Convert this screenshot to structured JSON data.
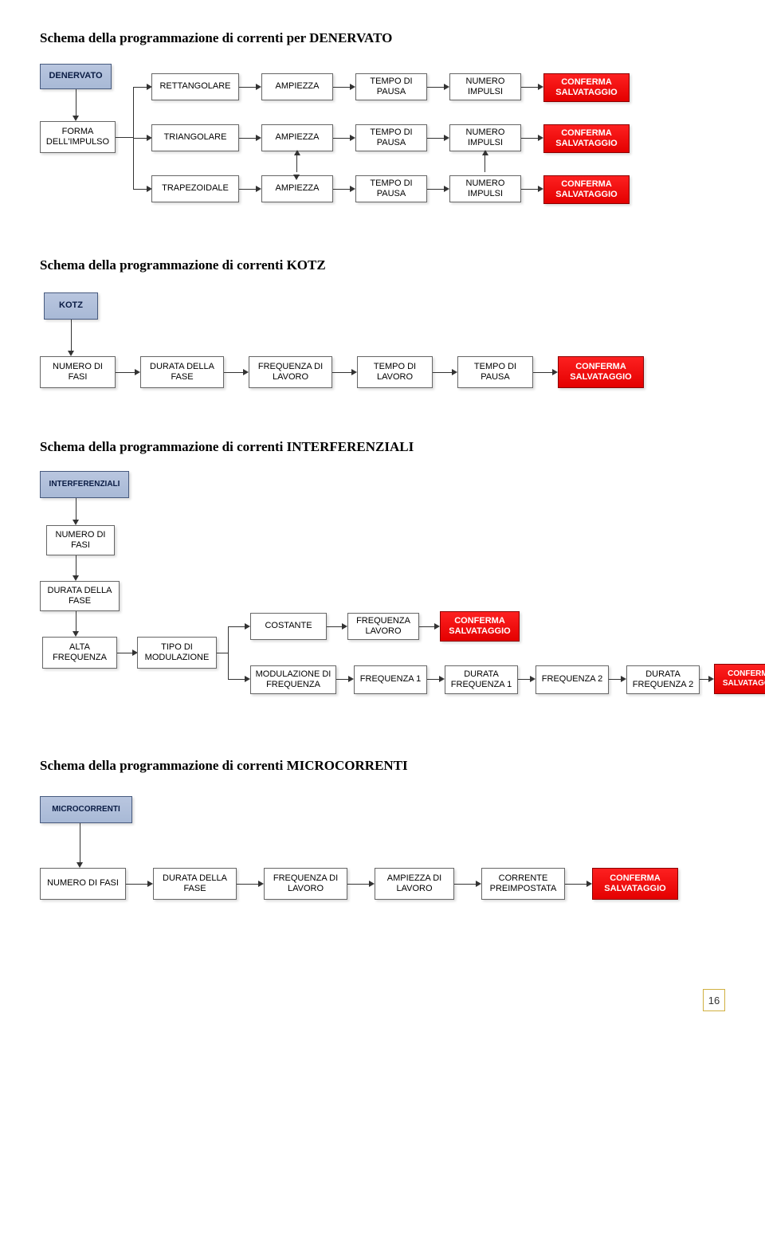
{
  "headings": {
    "denervato": "Schema della programmazione di correnti per DENERVATO",
    "kotz": "Schema della programmazione di correnti KOTZ",
    "interferenziali": "Schema della programmazione di correnti INTERFERENZIALI",
    "microcorrenti": "Schema della programmazione di correnti MICROCORRENTI"
  },
  "boxes": {
    "denervato": "DENERVATO",
    "forma_impulso": "FORMA DELL'IMPULSO",
    "rettangolare": "RETTANGOLARE",
    "triangolare": "TRIANGOLARE",
    "trapezoidale": "TRAPEZOIDALE",
    "ampiezza": "AMPIEZZA",
    "tempo_pausa": "TEMPO DI PAUSA",
    "numero_impulsi": "NUMERO IMPULSI",
    "conferma": "CONFERMA SALVATAGGIO",
    "kotz": "KOTZ",
    "numero_fasi": "NUMERO DI FASI",
    "durata_fase": "DURATA DELLA FASE",
    "freq_lavoro": "FREQUENZA DI LAVORO",
    "tempo_lavoro": "TEMPO DI LAVORO",
    "interferenziali": "INTERFERENZIALI",
    "alta_freq": "ALTA FREQUENZA",
    "tipo_modulazione": "TIPO DI MODULAZIONE",
    "costante": "COSTANTE",
    "freq_lavoro2": "FREQUENZA LAVORO",
    "mod_freq": "MODULAZIONE DI FREQUENZA",
    "frequenza1": "FREQUENZA 1",
    "durata_f1": "DURATA FREQUENZA 1",
    "frequenza2": "FREQUENZA 2",
    "durata_f2": "DURATA FREQUENZA 2",
    "microcorrenti": "MICROCORRENTI",
    "amp_lavoro": "AMPIEZZA DI LAVORO",
    "corr_preimp": "CORRENTE PREIMPOSTATA"
  },
  "page_number": "16"
}
